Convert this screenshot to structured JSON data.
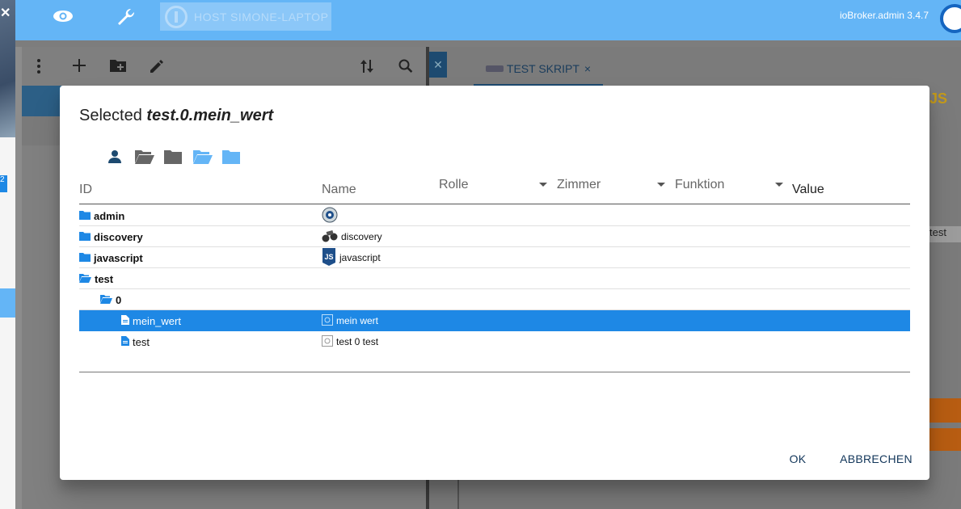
{
  "app": {
    "host_label": "HOST SIMONE-LAPTOP",
    "version": "ioBroker.admin 3.4.7",
    "side_badge": "2"
  },
  "editor": {
    "tab_label": "TEST SKRIPT",
    "tab_close": "×",
    "right_label": "test",
    "right_js": "JS"
  },
  "dialog": {
    "title_prefix": "Selected",
    "title_value": "test.0.mein_wert",
    "filter_icons": [
      "person-icon",
      "folder-open-icon",
      "folder-icon",
      "folder-open-blue-icon",
      "folder-blue-icon"
    ],
    "columns": {
      "id": "ID",
      "name": "Name",
      "role": "Rolle",
      "room": "Zimmer",
      "function": "Funktion",
      "value": "Value"
    },
    "rows": [
      {
        "id": "admin",
        "name": "",
        "icon": "admin-icon",
        "type": "folder"
      },
      {
        "id": "discovery",
        "name": "discovery",
        "icon": "binoculars-icon",
        "type": "folder"
      },
      {
        "id": "javascript",
        "name": "javascript",
        "icon": "js-icon",
        "type": "folder"
      },
      {
        "id": "test",
        "name": "",
        "icon": "",
        "type": "folder-open"
      },
      {
        "id": "0",
        "name": "",
        "icon": "",
        "type": "folder-open"
      },
      {
        "id": "mein_wert",
        "name": "mein wert",
        "icon": "state-icon",
        "type": "state",
        "selected": true
      },
      {
        "id": "test",
        "name": "test 0 test",
        "icon": "state-icon",
        "type": "state"
      }
    ],
    "ok_label": "OK",
    "cancel_label": "ABBRECHEN"
  },
  "colors": {
    "accent": "#1e88e5",
    "topbar": "#64b5f6",
    "button_text": "#12365a"
  }
}
